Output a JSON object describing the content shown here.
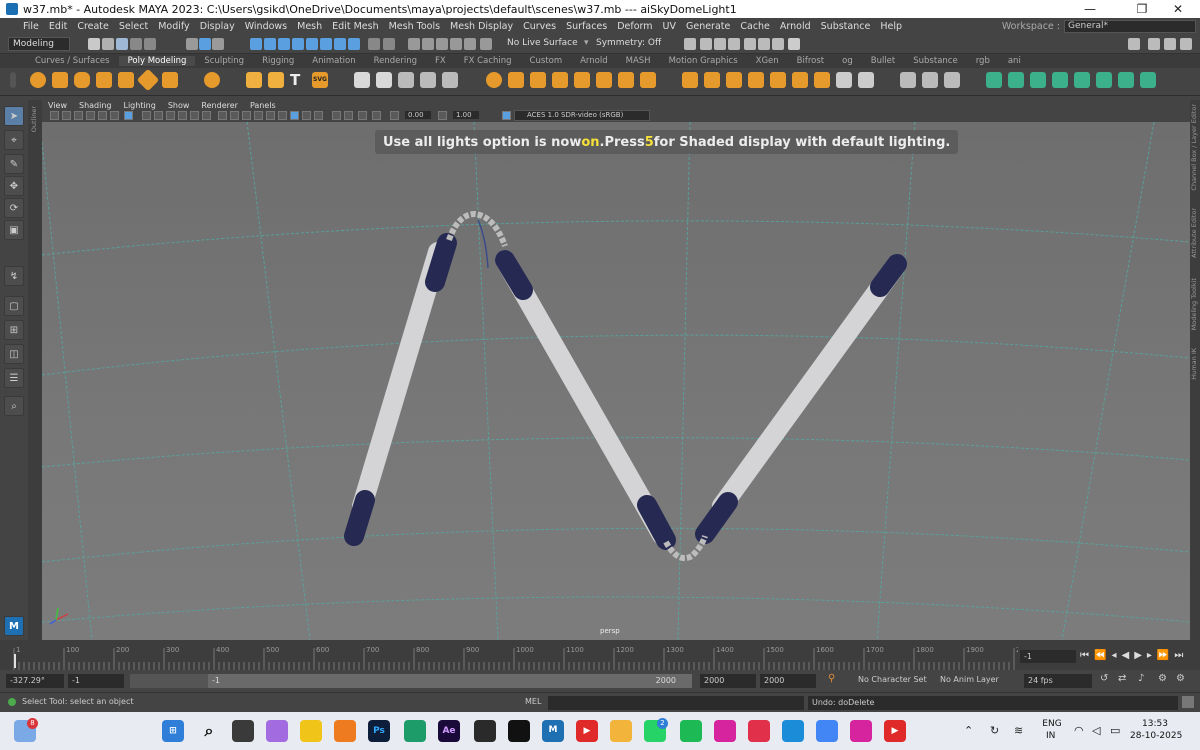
{
  "window": {
    "title": "w37.mb* - Autodesk MAYA 2023: C:\\Users\\gsikd\\OneDrive\\Documents\\maya\\projects\\default\\scenes\\w37.mb   ---   aiSkyDomeLight1",
    "minimize_glyph": "—",
    "restore_glyph": "❐",
    "close_glyph": "✕"
  },
  "menubar": {
    "items": [
      "File",
      "Edit",
      "Create",
      "Select",
      "Modify",
      "Display",
      "Windows",
      "Mesh",
      "Edit Mesh",
      "Mesh Tools",
      "Mesh Display",
      "Curves",
      "Surfaces",
      "Deform",
      "UV",
      "Generate",
      "Cache",
      "Arnold",
      "Substance",
      "Help"
    ],
    "workspace_label": "Workspace :",
    "workspace_value": "General*"
  },
  "statusline": {
    "mode": "Modeling",
    "live_surface": "No Live Surface",
    "symmetry": "Symmetry: Off"
  },
  "shelf": {
    "tabs": [
      "Curves / Surfaces",
      "Poly Modeling",
      "Sculpting",
      "Rigging",
      "Animation",
      "Rendering",
      "FX",
      "FX Caching",
      "Custom",
      "Arnold",
      "MASH",
      "Motion Graphics",
      "XGen",
      "Bifrost",
      "og",
      "Bullet",
      "Substance",
      "rgb",
      "ani"
    ],
    "active_tab": "Poly Modeling",
    "text_icon": "T",
    "svg_icon": "SVG"
  },
  "panel": {
    "menus": [
      "View",
      "Shading",
      "Lighting",
      "Show",
      "Renderer",
      "Panels"
    ],
    "exposure": "0.00",
    "gamma": "1.00",
    "color_space": "ACES 1.0 SDR-video (sRGB)"
  },
  "viewport": {
    "message_prefix": "Use all lights option is now ",
    "message_highlight": "on",
    "message_mid": ".Press ",
    "message_key": "5",
    "message_suffix": " for Shaded display with default lighting.",
    "camera_label": "persp",
    "highlight_color": "#f5e03a"
  },
  "sidebar_labels": {
    "outliner": "Outliner",
    "right": [
      "Channel Box / Layer Editor",
      "Attribute Editor",
      "Modeling Toolkit",
      "Human IK"
    ]
  },
  "timeline": {
    "ticks": [
      "1",
      "100",
      "200",
      "300",
      "400",
      "500",
      "600",
      "700",
      "800",
      "900",
      "1000",
      "1100",
      "1200",
      "1300",
      "1400",
      "1500",
      "1600",
      "1700",
      "1800",
      "1900",
      "20"
    ],
    "current_frame": "-1"
  },
  "range": {
    "rotation_value": "-327.29°",
    "start": "-1",
    "range_start": "-1",
    "range_end": "2000",
    "end": "2000",
    "anim_end": "2000",
    "character_set": "No Character Set",
    "anim_layer": "No Anim Layer",
    "fps": "24 fps"
  },
  "commandline": {
    "help": "Select Tool: select an object",
    "mel_label": "MEL",
    "result": "Undo: doDelete"
  },
  "taskbar": {
    "weather_badge": "8",
    "whatsapp_badge": "2",
    "language": "ENG",
    "region": "IN",
    "time": "13:53",
    "date": "28-10-2025",
    "maya_label": "M",
    "ps_label": "Ps",
    "ae_label": "Ae"
  }
}
